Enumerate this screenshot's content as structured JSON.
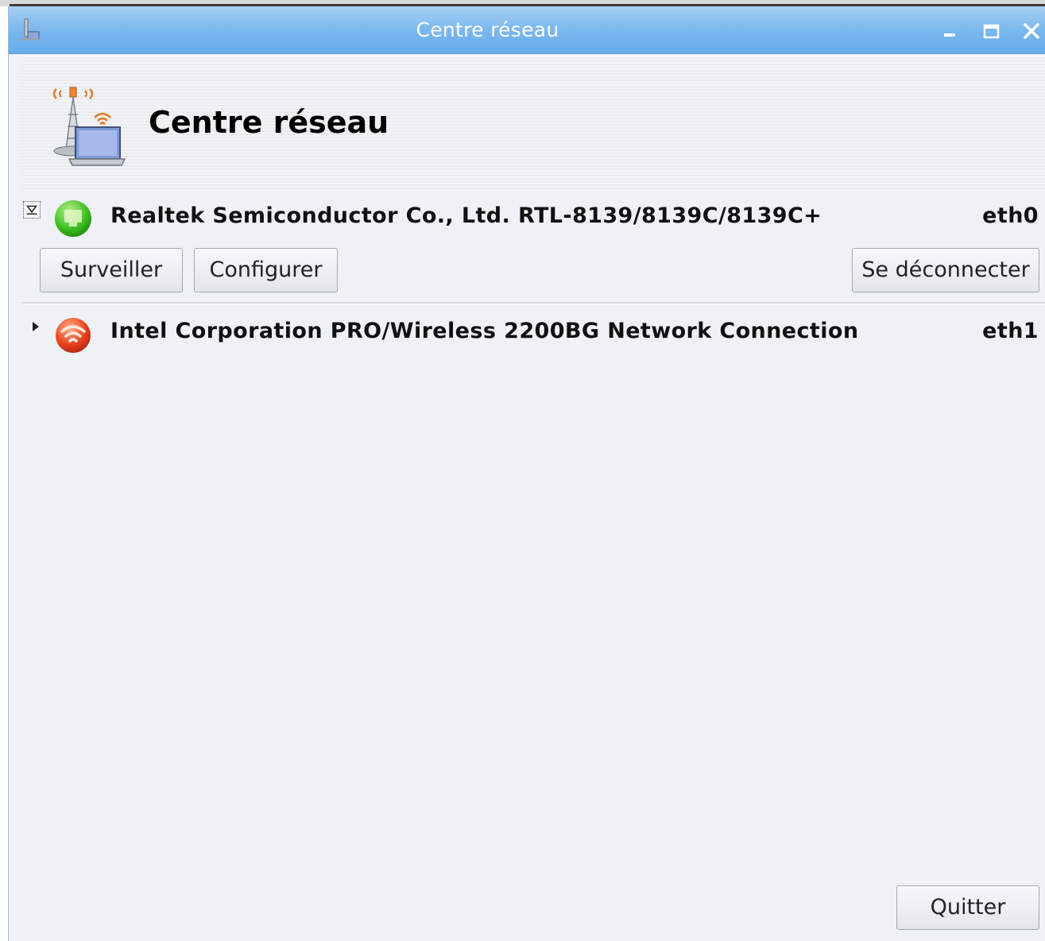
{
  "window": {
    "title": "Centre réseau"
  },
  "header": {
    "title": "Centre réseau"
  },
  "devices": [
    {
      "name": "Realtek Semiconductor Co., Ltd. RTL-8139/8139C/8139C+",
      "interface": "eth0",
      "status": "connected",
      "expanded": true,
      "status_color": "#3bbf1e",
      "actions": {
        "monitor": "Surveiller",
        "configure": "Configurer",
        "disconnect": "Se déconnecter"
      }
    },
    {
      "name": "Intel Corporation PRO/Wireless 2200BG Network Connection",
      "interface": "eth1",
      "status": "disconnected",
      "expanded": false,
      "status_color": "#e8401c"
    }
  ],
  "footer": {
    "quit": "Quitter"
  },
  "colors": {
    "titlebar": "#7ab8ee",
    "window_bg": "#eef1f6"
  }
}
